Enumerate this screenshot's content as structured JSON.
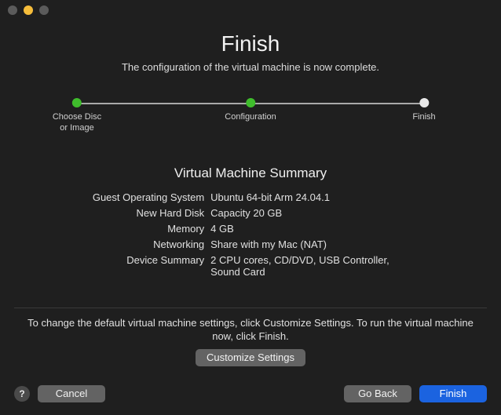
{
  "header": {
    "title": "Finish",
    "subtitle": "The configuration of the virtual machine is now complete."
  },
  "steps": [
    {
      "label_line1": "Choose Disc",
      "label_line2": "or Image",
      "state": "done"
    },
    {
      "label_line1": "Configuration",
      "label_line2": "",
      "state": "done"
    },
    {
      "label_line1": "Finish",
      "label_line2": "",
      "state": "current"
    }
  ],
  "summary": {
    "heading": "Virtual Machine Summary",
    "rows": [
      {
        "label": "Guest Operating System",
        "value": "Ubuntu 64-bit Arm 24.04.1"
      },
      {
        "label": "New Hard Disk",
        "value": "Capacity 20 GB"
      },
      {
        "label": "Memory",
        "value": "4 GB"
      },
      {
        "label": "Networking",
        "value": "Share with my Mac (NAT)"
      },
      {
        "label": "Device Summary",
        "value": "2 CPU cores, CD/DVD, USB Controller, Sound Card"
      }
    ]
  },
  "note": "To change the default virtual machine settings, click Customize Settings. To run the virtual machine now, click Finish.",
  "buttons": {
    "customize": "Customize Settings",
    "help": "?",
    "cancel": "Cancel",
    "back": "Go Back",
    "finish": "Finish"
  }
}
